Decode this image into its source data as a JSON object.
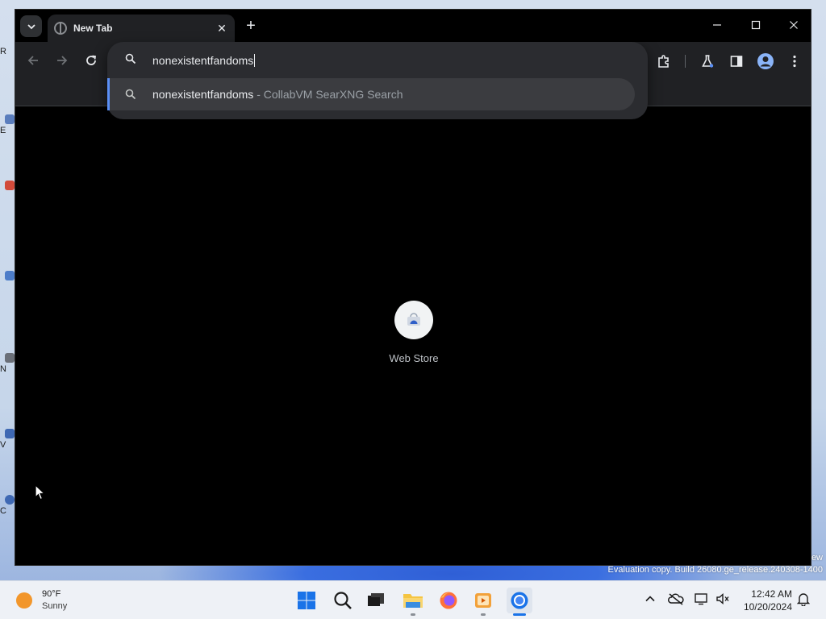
{
  "browser": {
    "tab": {
      "title": "New Tab",
      "close_glyph": "✕"
    },
    "new_tab_glyph": "+",
    "window_controls": {
      "minimize": "minimize-icon",
      "maximize": "maximize-icon",
      "close": "close-icon"
    },
    "omnibox": {
      "value": "nonexistentfandoms",
      "suggestion": {
        "query": "nonexistentfandoms",
        "separator": " - ",
        "engine": "CollabVM SearXNG Search"
      }
    },
    "ntp": {
      "shortcuts": [
        {
          "label": "Web Store",
          "icon": "web-store-icon"
        }
      ]
    },
    "colors": {
      "frame": "#000000",
      "toolbar": "#202124",
      "omnibox": "#2b2c30",
      "accent": "#5a8ff5"
    }
  },
  "desktop": {
    "icon_letters": [
      "R",
      "E",
      "",
      "",
      "N",
      "V",
      "",
      "C"
    ],
    "watermark": {
      "line1": "ew",
      "line2": "Evaluation copy. Build 26080.ge_release.240308-1400"
    }
  },
  "taskbar": {
    "weather": {
      "temp": "90°F",
      "condition": "Sunny"
    },
    "apps": [
      "start-icon",
      "search-icon",
      "task-view-icon",
      "file-explorer-icon",
      "firefox-icon",
      "media-player-icon",
      "chrome-icon"
    ],
    "tray": [
      "chevron-up-icon",
      "onedrive-icon",
      "network-icon",
      "volume-icon",
      "notification-bell-icon"
    ],
    "clock": {
      "time": "12:42 AM",
      "date": "10/20/2024"
    }
  }
}
